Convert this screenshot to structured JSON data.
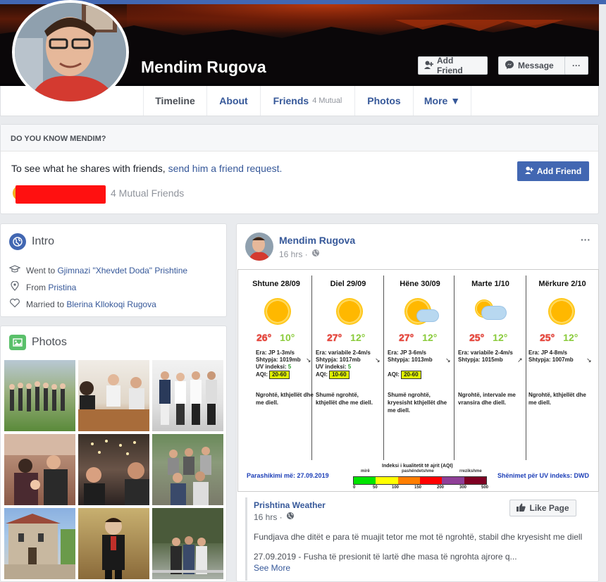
{
  "profile": {
    "name": "Mendim Rugova",
    "add_friend": "Add Friend",
    "message": "Message",
    "more_dots": "···"
  },
  "nav": {
    "tabs": [
      {
        "label": "Timeline"
      },
      {
        "label": "About"
      },
      {
        "label": "Friends",
        "sub": "4 Mutual"
      },
      {
        "label": "Photos"
      },
      {
        "label": "More ▼"
      }
    ]
  },
  "know": {
    "heading": "DO YOU KNOW MENDIM?",
    "text": "To see what he shares with friends, ",
    "link": "send him a friend request.",
    "add_friend": "Add Friend",
    "mutual": "4 Mutual Friends"
  },
  "intro": {
    "title": "Intro",
    "rows": [
      {
        "prefix": "Went to ",
        "link": "Gjimnazi \"Xhevdet Doda\" Prishtine"
      },
      {
        "prefix": "From ",
        "link": "Pristina"
      },
      {
        "prefix": "Married to ",
        "link": "Blerina Kllokoqi Rugova"
      }
    ]
  },
  "photos": {
    "title": "Photos"
  },
  "post": {
    "author": "Mendim Rugova",
    "time": "16 hrs ·",
    "more": "···"
  },
  "forecast": {
    "days": [
      {
        "name": "Shtune 28/09",
        "hi": "26°",
        "lo": "10°",
        "l1": "Era: JP 1-3m/s",
        "l2": "Shtypja: 1019mb",
        "l3": "UV indeksi: ",
        "uv": "5",
        "aqi_label": "AQI: ",
        "aqi": "20-60",
        "desc": "Ngrohtë, kthjellët dhe me diell."
      },
      {
        "name": "Diel 29/09",
        "hi": "27°",
        "lo": "12°",
        "l1": "Era: variabile 2-4m/s",
        "l2": "Shtypja: 1017mb",
        "l3": "UV indeksi: ",
        "uv": "5",
        "aqi_label": "AQI: ",
        "aqi": "10-60",
        "desc": "Shumë ngrohtë, kthjellët dhe me diell."
      },
      {
        "name": "Hëne 30/09",
        "hi": "27°",
        "lo": "12°",
        "l1": "Era: JP 3-6m/s",
        "l2": "Shtypja: 1013mb",
        "l3": "",
        "uv": "",
        "aqi_label": "AQI: ",
        "aqi": "20-60",
        "desc": "Shumë ngrohtë, kryesisht kthjellët dhe me diell."
      },
      {
        "name": "Marte 1/10",
        "hi": "25°",
        "lo": "12°",
        "l1": "Era: variabile 2-4m/s",
        "l2": "Shtypja: 1015mb",
        "l3": "",
        "uv": "",
        "aqi_label": "",
        "aqi": "",
        "desc": "Ngrohtë, intervale me vransira dhe diell."
      },
      {
        "name": "Mërkure 2/10",
        "hi": "25°",
        "lo": "12°",
        "l1": "Era: JP 4-8m/s",
        "l2": "Shtypja: 1007mb",
        "l3": "",
        "uv": "",
        "aqi_label": "",
        "aqi": "",
        "desc": "Ngrohtë, kthjellët dhe me diell."
      }
    ],
    "footer_left": "Parashikimi më: 27.09.2019",
    "footer_right": "Shënimet për UV indeks: DWD",
    "scale_title": "Indeksi i kualitetit të ajrit (AQI)",
    "scale_labels": [
      "mirë",
      "pashëndetshme",
      "rrezikshme"
    ],
    "scale_numbers": [
      "0",
      "50",
      "100",
      "150",
      "200",
      "300",
      "500"
    ],
    "scale_colors": [
      "#00e400",
      "#ffff00",
      "#ff7e00",
      "#ff0000",
      "#8f3f97",
      "#7e0023"
    ]
  },
  "shared": {
    "page": "Prishtina Weather",
    "time": "16 hrs ·",
    "like": "Like Page",
    "text1": "Fundjava dhe ditët e para të muajit tetor me mot të ngrohtë, stabil dhe kryesisht me diell",
    "text2": "27.09.2019 - Fusha të presionit të lartë dhe masa të ngrohta ajrore q...",
    "see_more": "See More"
  }
}
